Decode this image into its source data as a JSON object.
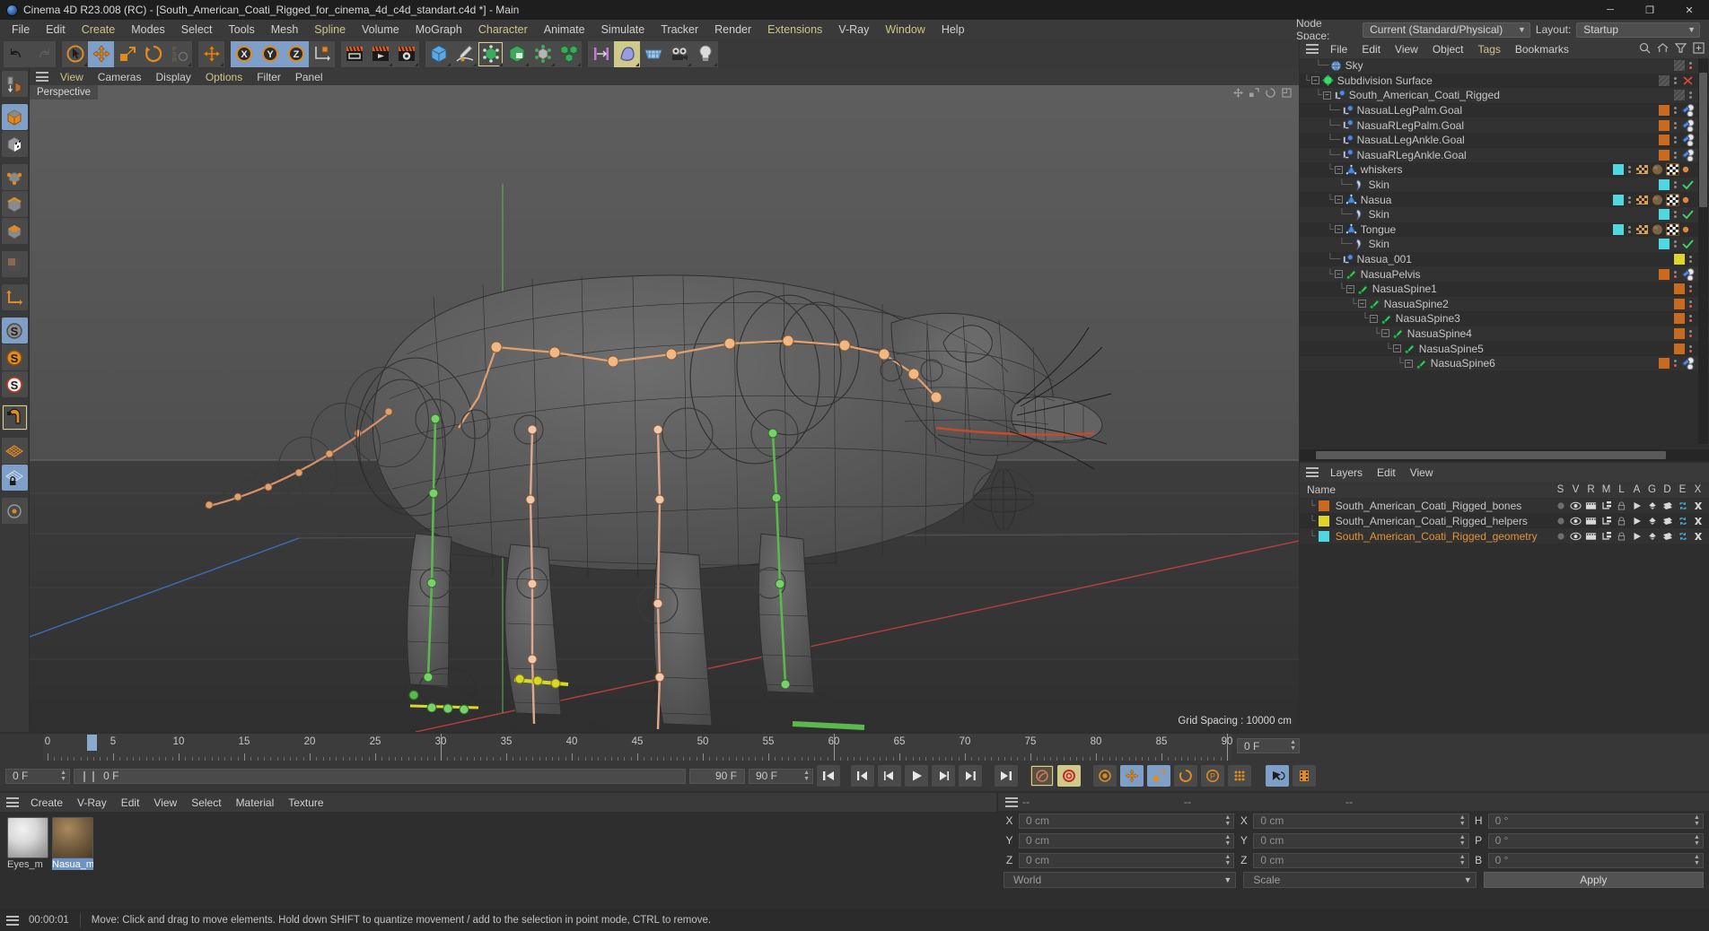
{
  "window": {
    "title": "Cinema 4D R23.008 (RC) - [South_American_Coati_Rigged_for_cinema_4d_c4d_standart.c4d *] - Main",
    "minimize": "─",
    "maximize": "❐",
    "close": "✕"
  },
  "menubar": {
    "items": [
      {
        "label": "File",
        "highlight": false
      },
      {
        "label": "Edit",
        "highlight": false
      },
      {
        "label": "Create",
        "highlight": true
      },
      {
        "label": "Modes",
        "highlight": false
      },
      {
        "label": "Select",
        "highlight": false
      },
      {
        "label": "Tools",
        "highlight": false
      },
      {
        "label": "Mesh",
        "highlight": false
      },
      {
        "label": "Spline",
        "highlight": true
      },
      {
        "label": "Volume",
        "highlight": false
      },
      {
        "label": "MoGraph",
        "highlight": false
      },
      {
        "label": "Character",
        "highlight": true
      },
      {
        "label": "Animate",
        "highlight": false
      },
      {
        "label": "Simulate",
        "highlight": false
      },
      {
        "label": "Tracker",
        "highlight": false
      },
      {
        "label": "Render",
        "highlight": false
      },
      {
        "label": "Extensions",
        "highlight": true
      },
      {
        "label": "V-Ray",
        "highlight": false
      },
      {
        "label": "Window",
        "highlight": true
      },
      {
        "label": "Help",
        "highlight": false
      }
    ]
  },
  "topright": {
    "node_space_label": "Node Space:",
    "node_space_value": "Current (Standard/Physical)",
    "layout_label": "Layout:",
    "layout_value": "Startup"
  },
  "viewport": {
    "menu": [
      {
        "label": "View",
        "highlight": true
      },
      {
        "label": "Cameras",
        "highlight": false
      },
      {
        "label": "Display",
        "highlight": false
      },
      {
        "label": "Options",
        "highlight": true
      },
      {
        "label": "Filter",
        "highlight": false
      },
      {
        "label": "Panel",
        "highlight": false
      }
    ],
    "tag": "Perspective",
    "grid_spacing": "Grid Spacing : 10000 cm",
    "axis_x": "X",
    "axis_y": "Y",
    "axis_z": "Z"
  },
  "object_manager": {
    "menu": [
      {
        "label": "File",
        "highlight": false
      },
      {
        "label": "Edit",
        "highlight": false
      },
      {
        "label": "View",
        "highlight": false
      },
      {
        "label": "Object",
        "highlight": false
      },
      {
        "label": "Tags",
        "highlight": true
      },
      {
        "label": "Bookmarks",
        "highlight": false
      }
    ],
    "rows": [
      {
        "name": "Sky",
        "depth": 1,
        "icon": "sky",
        "expander": "none",
        "swatch": "hatch",
        "dot_color": "#e05a4e",
        "tags": []
      },
      {
        "name": "Subdivision Surface",
        "depth": 0,
        "icon": "subdiv",
        "expander": "minus",
        "swatch": "hatch",
        "dot_color": "#8a8a8a",
        "tags": [
          "x"
        ]
      },
      {
        "name": "South_American_Coati_Rigged",
        "depth": 1,
        "icon": "null",
        "expander": "minus",
        "swatch": "hatch",
        "dot_color": "#8a8a8a",
        "tags": []
      },
      {
        "name": "NasuaLLegPalm.Goal",
        "depth": 2,
        "icon": "null",
        "expander": "none",
        "swatch": "#c96a1e",
        "dot_color": "#8a8a8a",
        "tags": [
          "constraint"
        ]
      },
      {
        "name": "NasuaRLegPalm.Goal",
        "depth": 2,
        "icon": "null",
        "expander": "none",
        "swatch": "#c96a1e",
        "dot_color": "#8a8a8a",
        "tags": [
          "constraint"
        ]
      },
      {
        "name": "NasuaLLegAnkle.Goal",
        "depth": 2,
        "icon": "null",
        "expander": "none",
        "swatch": "#c96a1e",
        "dot_color": "#8a8a8a",
        "tags": [
          "constraint"
        ]
      },
      {
        "name": "NasuaRLegAnkle.Goal",
        "depth": 2,
        "icon": "null",
        "expander": "none",
        "swatch": "#c96a1e",
        "dot_color": "#8a8a8a",
        "tags": [
          "constraint"
        ]
      },
      {
        "name": "whiskers",
        "depth": 2,
        "icon": "poly",
        "expander": "minus",
        "swatch": "#4fd8e0",
        "dot_color": "#8a8a8a",
        "tags": [
          "weight",
          "material",
          "uv",
          "dot"
        ]
      },
      {
        "name": "Skin",
        "depth": 3,
        "icon": "skin",
        "expander": "none",
        "swatch": "#4fd8e0",
        "dot_color": "#8a8a8a",
        "tags": [
          "check"
        ]
      },
      {
        "name": "Nasua",
        "depth": 2,
        "icon": "poly",
        "expander": "minus",
        "swatch": "#4fd8e0",
        "dot_color": "#8a8a8a",
        "tags": [
          "weight",
          "material",
          "uv",
          "dot"
        ]
      },
      {
        "name": "Skin",
        "depth": 3,
        "icon": "skin",
        "expander": "none",
        "swatch": "#4fd8e0",
        "dot_color": "#8a8a8a",
        "tags": [
          "check"
        ]
      },
      {
        "name": "Tongue",
        "depth": 2,
        "icon": "poly",
        "expander": "minus",
        "swatch": "#4fd8e0",
        "dot_color": "#8a8a8a",
        "tags": [
          "weight",
          "material",
          "uv",
          "dot"
        ]
      },
      {
        "name": "Skin",
        "depth": 3,
        "icon": "skin",
        "expander": "none",
        "swatch": "#4fd8e0",
        "dot_color": "#8a8a8a",
        "tags": [
          "check"
        ]
      },
      {
        "name": "Nasua_001",
        "depth": 2,
        "icon": "null",
        "expander": "none",
        "swatch": "#e0d427",
        "dot_color": "#8a8a8a",
        "tags": []
      },
      {
        "name": "NasuaPelvis",
        "depth": 2,
        "icon": "joint",
        "expander": "minus",
        "swatch": "#c96a1e",
        "dot_color": "#e05a4e",
        "tags": [
          "constraint"
        ]
      },
      {
        "name": "NasuaSpine1",
        "depth": 3,
        "icon": "joint",
        "expander": "minus",
        "swatch": "#c96a1e",
        "dot_color": "#e05a4e",
        "tags": []
      },
      {
        "name": "NasuaSpine2",
        "depth": 4,
        "icon": "joint",
        "expander": "minus",
        "swatch": "#c96a1e",
        "dot_color": "#e05a4e",
        "tags": []
      },
      {
        "name": "NasuaSpine3",
        "depth": 5,
        "icon": "joint",
        "expander": "minus",
        "swatch": "#c96a1e",
        "dot_color": "#e05a4e",
        "tags": []
      },
      {
        "name": "NasuaSpine4",
        "depth": 6,
        "icon": "joint",
        "expander": "minus",
        "swatch": "#c96a1e",
        "dot_color": "#e05a4e",
        "tags": []
      },
      {
        "name": "NasuaSpine5",
        "depth": 7,
        "icon": "joint",
        "expander": "minus",
        "swatch": "#c96a1e",
        "dot_color": "#e05a4e",
        "tags": []
      },
      {
        "name": "NasuaSpine6",
        "depth": 8,
        "icon": "joint",
        "expander": "minus",
        "swatch": "#c96a1e",
        "dot_color": "#e05a4e",
        "tags": [
          "constraint"
        ]
      }
    ]
  },
  "layer_manager": {
    "menu": [
      {
        "label": "Layers",
        "highlight": false
      },
      {
        "label": "Edit",
        "highlight": false
      },
      {
        "label": "View",
        "highlight": false
      }
    ],
    "name_header": "Name",
    "columns": [
      "S",
      "V",
      "R",
      "M",
      "L",
      "A",
      "G",
      "D",
      "E",
      "X"
    ],
    "rows": [
      {
        "name": "South_American_Coati_Rigged_bones",
        "color": "#c96a1e",
        "selected": false
      },
      {
        "name": "South_American_Coati_Rigged_helpers",
        "color": "#e0d427",
        "selected": false
      },
      {
        "name": "South_American_Coati_Rigged_geometry",
        "color": "#4fd8e0",
        "selected": true
      }
    ]
  },
  "timeline": {
    "ticks": [
      0,
      5,
      10,
      15,
      20,
      25,
      30,
      35,
      40,
      45,
      50,
      55,
      60,
      65,
      70,
      75,
      80,
      85,
      90
    ],
    "current_frame": "0 F",
    "current_frame_2": "0 F",
    "end_frame": "90 F",
    "end_frame_2": "90 F",
    "preview_frame": "0 F",
    "transport": [
      "go-to-start",
      "previous-key",
      "previous-frame",
      "play",
      "next-frame",
      "next-key",
      "go-to-end"
    ]
  },
  "material_manager": {
    "menu": [
      {
        "label": "Create",
        "highlight": false
      },
      {
        "label": "V-Ray",
        "highlight": false
      },
      {
        "label": "Edit",
        "highlight": false
      },
      {
        "label": "View",
        "highlight": false
      },
      {
        "label": "Select",
        "highlight": false
      },
      {
        "label": "Material",
        "highlight": false
      },
      {
        "label": "Texture",
        "highlight": false
      }
    ],
    "materials": [
      {
        "label": "Eyes_m",
        "selected": false,
        "kind": "glass"
      },
      {
        "label": "Nasua_m",
        "selected": true,
        "kind": "fur"
      }
    ]
  },
  "coordinate_manager": {
    "header": [
      "--",
      "--",
      "--"
    ],
    "position": {
      "x_key": "X",
      "x": "0 cm",
      "y_key": "Y",
      "y": "0 cm",
      "z_key": "Z",
      "z": "0 cm"
    },
    "size": {
      "x_key": "X",
      "x": "0 cm",
      "y_key": "Y",
      "y": "0 cm",
      "z_key": "Z",
      "z": "0 cm"
    },
    "rotation": {
      "h_key": "H",
      "h": "0 °",
      "p_key": "P",
      "p": "0 °",
      "b_key": "B",
      "b": "0 °"
    },
    "space_value": "World",
    "mode_value": "Scale",
    "apply_label": "Apply"
  },
  "status_bar": {
    "time": "00:00:01",
    "message": "Move: Click and drag to move elements. Hold down SHIFT to quantize movement / add to the selection in point mode, CTRL to remove."
  },
  "colors": {
    "accent_orange": "#e0933a",
    "selection_blue": "#7d9fc8",
    "bones": "#c96a1e",
    "helpers": "#e0d427",
    "geometry": "#4fd8e0"
  }
}
